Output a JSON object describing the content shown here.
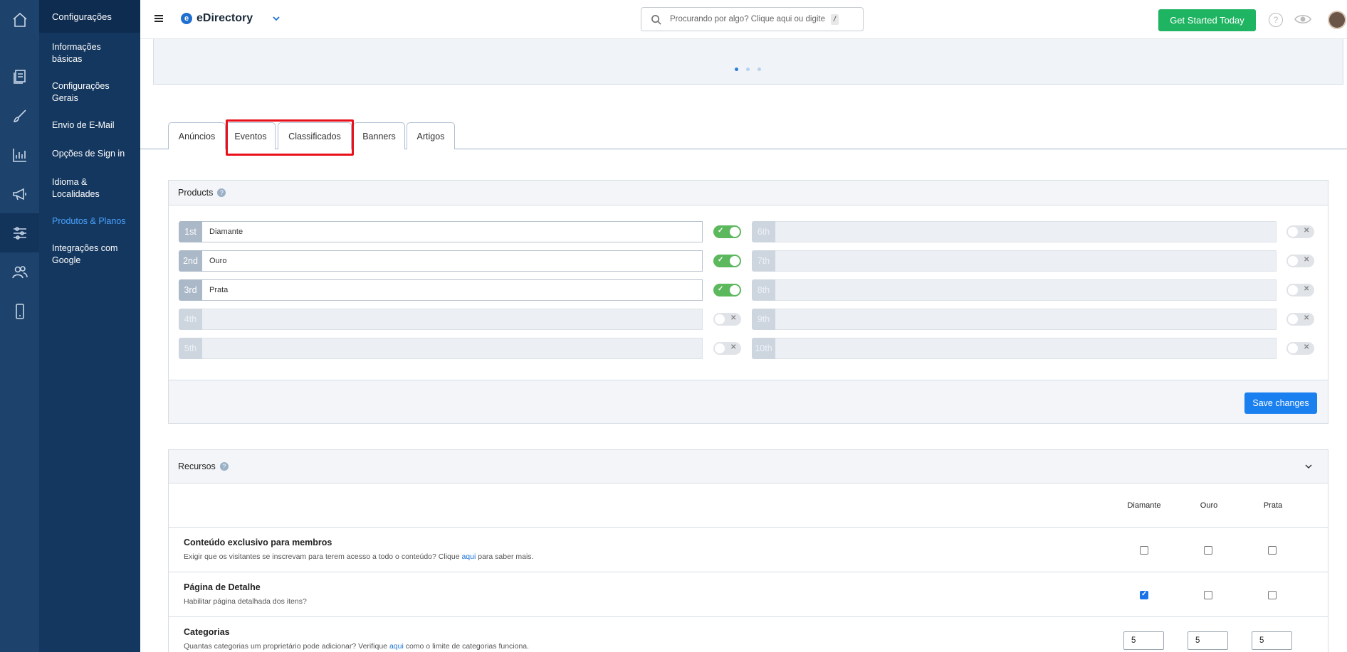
{
  "topbar": {
    "brand": "eDirectory",
    "search_placeholder": "Procurando por algo? Clique aqui ou digite",
    "search_key": "/",
    "cta": "Get Started Today",
    "help_glyph": "?"
  },
  "sidebar": {
    "header": "Configurações",
    "items": [
      {
        "label": "Informações básicas"
      },
      {
        "label": "Configurações Gerais"
      },
      {
        "label": "Envio de E-Mail"
      },
      {
        "label": "Opções de Sign in"
      },
      {
        "label": "Idioma & Localidades"
      },
      {
        "label": "Produtos & Planos"
      },
      {
        "label": "Integrações com Google"
      }
    ]
  },
  "tabs": [
    "Anúncios",
    "Eventos",
    "Classificados",
    "Banners",
    "Artigos"
  ],
  "products": {
    "title": "Products",
    "rows_left": [
      {
        "num": "1st",
        "name": "Diamante",
        "enabled": true
      },
      {
        "num": "2nd",
        "name": "Ouro",
        "enabled": true
      },
      {
        "num": "3rd",
        "name": "Prata",
        "enabled": true
      },
      {
        "num": "4th",
        "name": "",
        "enabled": false
      },
      {
        "num": "5th",
        "name": "",
        "enabled": false
      }
    ],
    "rows_right": [
      {
        "num": "6th",
        "name": "",
        "enabled": false
      },
      {
        "num": "7th",
        "name": "",
        "enabled": false
      },
      {
        "num": "8th",
        "name": "",
        "enabled": false
      },
      {
        "num": "9th",
        "name": "",
        "enabled": false
      },
      {
        "num": "10th",
        "name": "",
        "enabled": false
      }
    ],
    "save_label": "Save changes"
  },
  "features": {
    "title": "Recursos",
    "columns": [
      "Diamante",
      "Ouro",
      "Prata"
    ],
    "rows": [
      {
        "title": "Conteúdo exclusivo para membros",
        "desc_before": "Exigir que os visitantes se inscrevam para terem acesso a todo o conteúdo? Clique ",
        "link": "aqui",
        "desc_after": " para saber mais.",
        "checks": [
          false,
          false,
          false
        ]
      },
      {
        "title": "Página de Detalhe",
        "desc_before": "Habilitar página detalhada dos itens?",
        "link": "",
        "desc_after": "",
        "checks": [
          true,
          false,
          false
        ]
      },
      {
        "title": "Categorias",
        "desc_before": "Quantas categorias um proprietário pode adicionar? Verifique ",
        "link": "aqui",
        "desc_after": " como o limite de categorias funciona.",
        "values": [
          "5",
          "5",
          "5"
        ]
      }
    ]
  }
}
